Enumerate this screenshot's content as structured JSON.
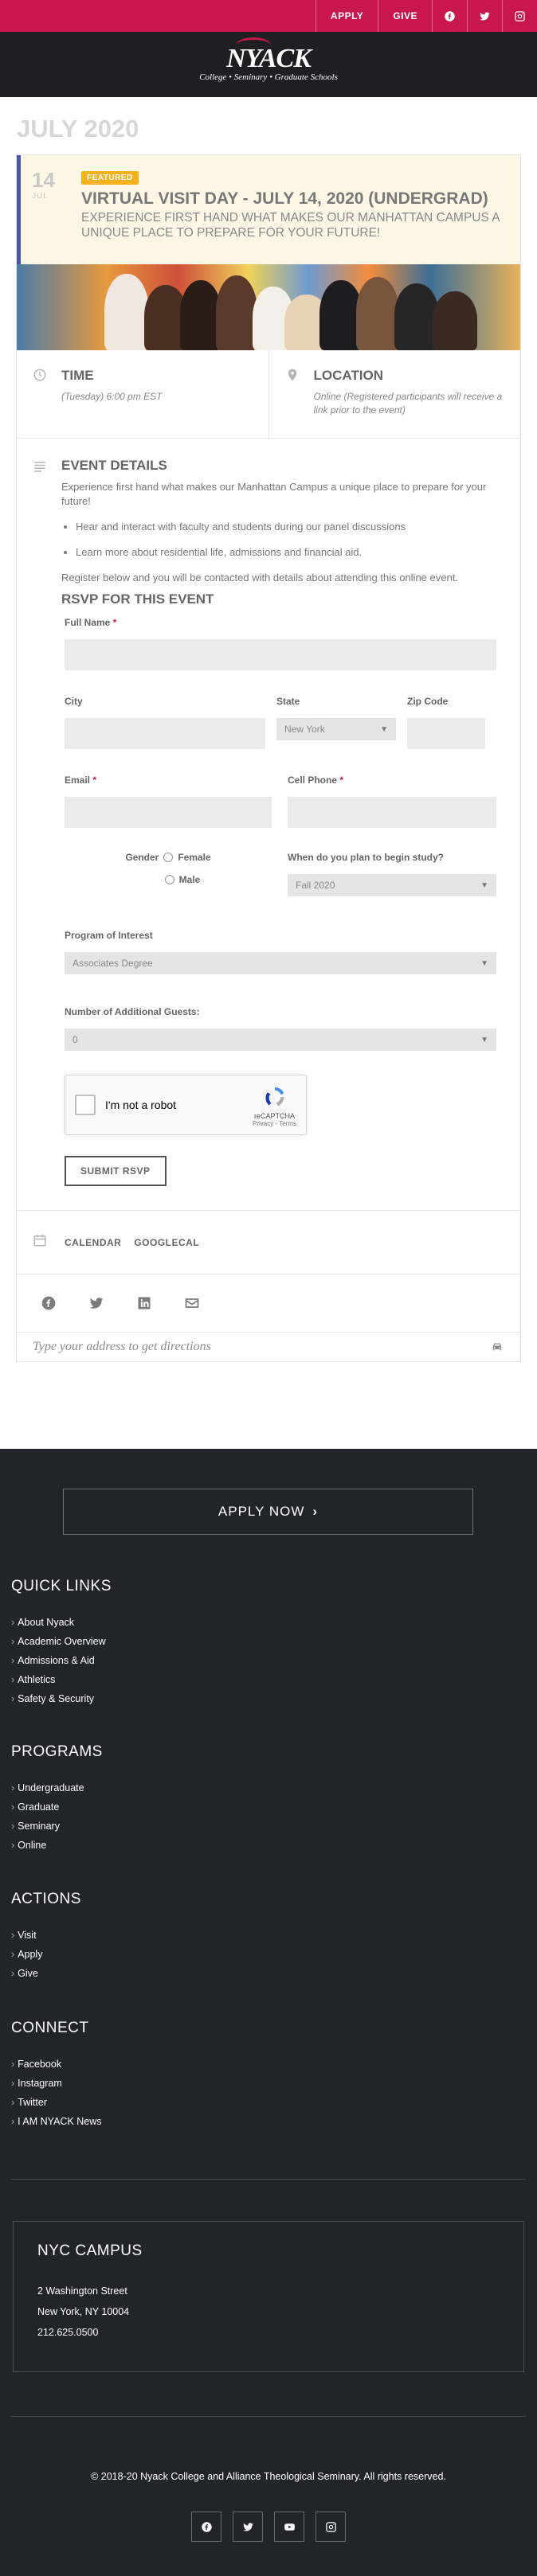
{
  "topbar": {
    "apply": "APPLY",
    "give": "GIVE",
    "icons": [
      "facebook-icon",
      "twitter-icon",
      "instagram-icon"
    ]
  },
  "brand": {
    "logo_word": "NYACK",
    "logo_sub": "College • Seminary • Graduate Schools",
    "accent": "#c8174d",
    "dark": "#1f1f22"
  },
  "page": {
    "heading": "JULY 2020"
  },
  "event": {
    "day": "14",
    "month": "JUL",
    "badge": "FEATURED",
    "title": "VIRTUAL VISIT DAY - JULY 14, 2020 (UNDERGRAD)",
    "subtitle": "EXPERIENCE FIRST HAND WHAT MAKES OUR MANHATTAN CAMPUS A UNIQUE PLACE TO PREPARE FOR YOUR FUTURE!",
    "time_title": "TIME",
    "time_text": "(Tuesday) 6:00 pm EST",
    "location_title": "LOCATION",
    "location_text": "Online (Registered participants will receive a link prior to the event)",
    "details_title": "EVENT DETAILS",
    "details_intro": "Experience first hand what makes our Manhattan Campus a unique place to prepare for your future!",
    "bullets": [
      "Hear and interact with faculty and students during our panel discussions",
      "Learn more about residential life, admissions and financial aid."
    ],
    "register_text": "Register below and you will be contacted with details about attending this online event."
  },
  "form": {
    "title": "RSVP FOR THIS EVENT",
    "full_name": "Full Name",
    "city": "City",
    "state": "State",
    "state_value": "New York",
    "zip": "Zip Code",
    "email": "Email",
    "cell": "Cell Phone",
    "gender": "Gender",
    "female": "Female",
    "male": "Male",
    "study_q": "When do you plan to begin study?",
    "study_value": "Fall 2020",
    "program": "Program of Interest",
    "program_value": "Associates Degree",
    "guests": "Number of Additional Guests:",
    "guests_value": "0",
    "captcha": "I'm not a robot",
    "captcha_brand": "reCAPTCHA",
    "captcha_links": "Privacy - Terms",
    "submit": "SUBMIT RSVP"
  },
  "calendar": {
    "calendar": "CALENDAR",
    "google": "GOOGLECAL"
  },
  "share": [
    "facebook-icon",
    "twitter-icon",
    "linkedin-icon",
    "email-icon"
  ],
  "directions": {
    "placeholder": "Type your address to get directions"
  },
  "footer": {
    "apply_now": "APPLY NOW",
    "quick_links_title": "QUICK LINKS",
    "quick_links": [
      "About Nyack",
      "Academic Overview",
      "Admissions & Aid",
      "Athletics",
      "Safety & Security"
    ],
    "programs_title": "PROGRAMS",
    "programs": [
      "Undergraduate",
      "Graduate",
      "Seminary",
      "Online"
    ],
    "actions_title": "ACTIONS",
    "actions": [
      "Visit",
      "Apply",
      "Give"
    ],
    "connect_title": "CONNECT",
    "connect": [
      "Facebook",
      "Instagram",
      "Twitter",
      "I AM NYACK News"
    ],
    "campus_title": "NYC CAMPUS",
    "campus_lines": [
      "2 Washington Street",
      "New York, NY 10004",
      "212.625.0500"
    ],
    "copyright": "© 2018-20 Nyack College and Alliance Theological Seminary. All rights reserved.",
    "social": [
      "facebook-icon",
      "twitter-icon",
      "youtube-icon",
      "instagram-icon"
    ]
  }
}
